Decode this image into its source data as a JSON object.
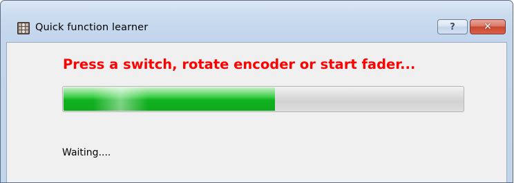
{
  "window": {
    "title": "Quick function learner",
    "help_label": "?",
    "close_label": "✕"
  },
  "main": {
    "prompt": "Press a switch, rotate encoder or start fader...",
    "progress_fraction": 0.53,
    "status": "Waiting...."
  },
  "colors": {
    "prompt": "#ff0000",
    "progress_fill": "#12b01f",
    "close_button": "#c9472f"
  }
}
